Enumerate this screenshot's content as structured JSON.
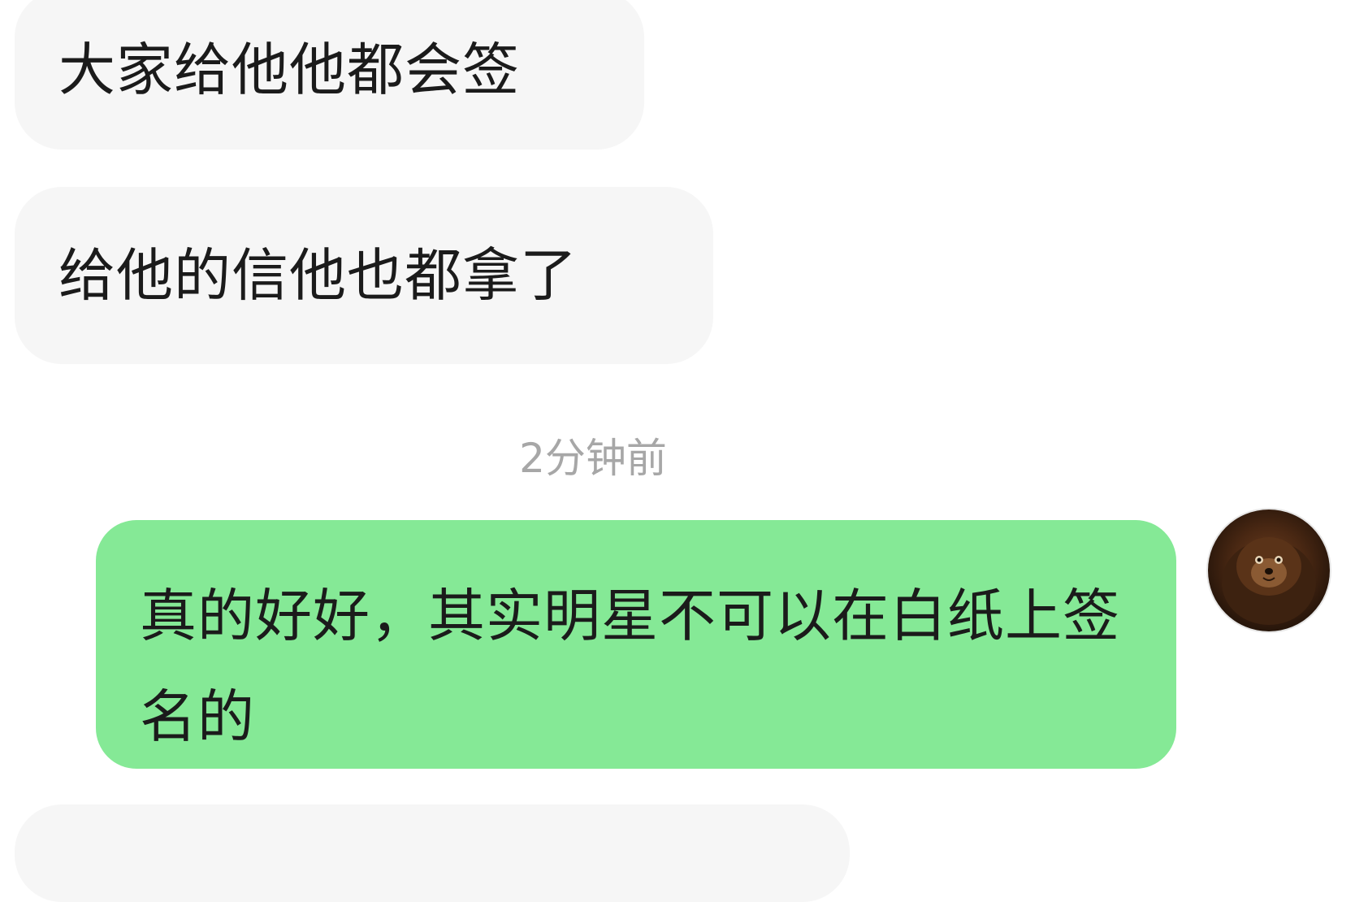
{
  "messages": [
    {
      "side": "incoming",
      "text": "大家给他他都会签"
    },
    {
      "side": "incoming",
      "text": "给他的信他也都拿了"
    },
    {
      "side": "outgoing",
      "text": "真的好好，其实明星不可以在白纸上签名的"
    },
    {
      "side": "incoming",
      "text": ""
    }
  ],
  "timestamp": "2分钟前",
  "colors": {
    "incoming_bubble": "#f6f6f6",
    "outgoing_bubble": "#85e996",
    "timestamp_text": "#a7a7a7",
    "background": "#ffffff"
  },
  "avatar": {
    "icon": "user-avatar-pet-photo"
  }
}
